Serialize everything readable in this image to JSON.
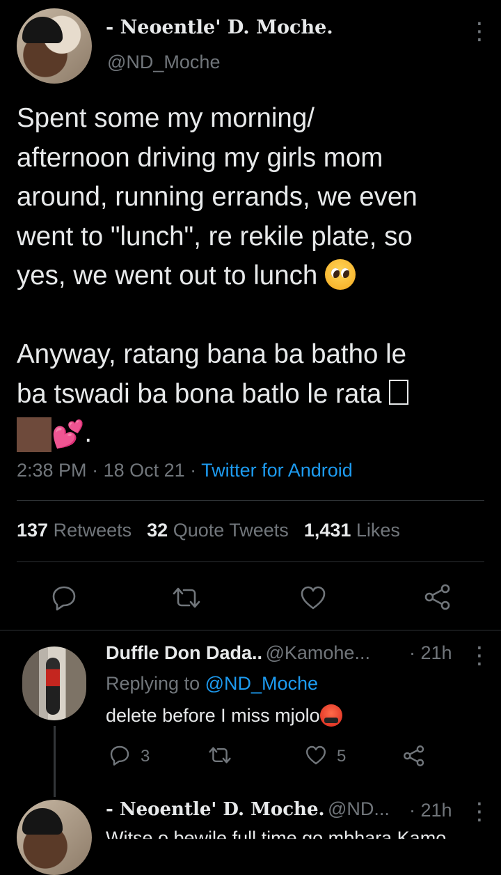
{
  "tweet": {
    "author_name": "- Neoentle' D. Moche.",
    "author_handle": "@ND_Moche",
    "text_p1": "Spent some my morning/\nafternoon driving my girls mom\naround, running errands, we even\nwent to \"lunch\", re rekile plate, so\nyes, we went out to lunch",
    "text_p2a": "Anyway, ratang bana ba batho le\nba tswadi ba bona batlo le rata",
    "time": "2:38 PM",
    "date": "18 Oct 21",
    "source": "Twitter for Android",
    "separator": " · ",
    "period": "."
  },
  "stats": {
    "retweets_count": "137",
    "retweets_label": "Retweets",
    "quotes_count": "32",
    "quotes_label": "Quote Tweets",
    "likes_count": "1,431",
    "likes_label": "Likes"
  },
  "icons": {
    "tweet_emojis": [
      "pleading-face-emoji",
      "brown-square-emoji",
      "two-hearts-emoji"
    ],
    "reply_emoji": "angry-face-emoji",
    "actions": [
      "reply-icon",
      "retweet-icon",
      "like-icon",
      "share-icon"
    ]
  },
  "colors": {
    "background": "#000000",
    "text": "#e7e9ea",
    "secondary": "#71767b",
    "accent": "#1d9bf0",
    "divider": "#2f3336"
  },
  "replies": [
    {
      "name": "Duffle Don Dada..",
      "handle": "@Kamohe...",
      "time": "· 21h",
      "replying_prefix": "Replying to",
      "replying_to": "@ND_Moche",
      "text": "delete before I miss mjolo",
      "reply_count": "3",
      "like_count": "5"
    },
    {
      "name": "- Neoentle' D. Moche.",
      "handle": "@ND...",
      "time": "· 21h",
      "text": "Witse o bewile full time go mbhara Kamo..."
    }
  ]
}
